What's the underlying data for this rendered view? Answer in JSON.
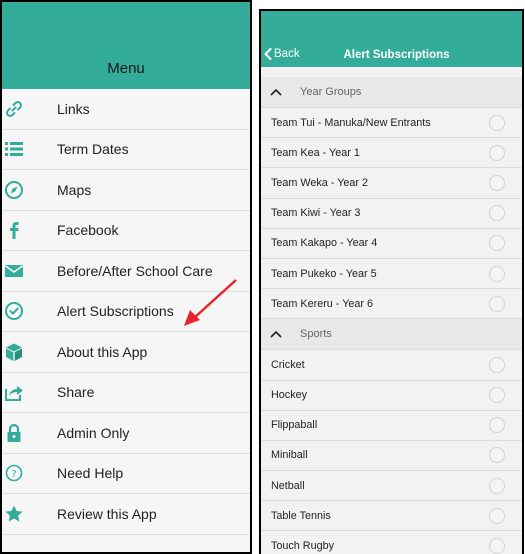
{
  "menu": {
    "title": "Menu",
    "accent": "#33ad9a",
    "items": [
      {
        "label": "Links",
        "icon": "link-icon"
      },
      {
        "label": "Term Dates",
        "icon": "list-icon"
      },
      {
        "label": "Maps",
        "icon": "compass-icon"
      },
      {
        "label": "Facebook",
        "icon": "facebook-icon"
      },
      {
        "label": "Before/After School Care",
        "icon": "envelope-icon"
      },
      {
        "label": "Alert Subscriptions",
        "icon": "check-circle-icon"
      },
      {
        "label": "About this App",
        "icon": "cube-icon"
      },
      {
        "label": "Share",
        "icon": "share-icon"
      },
      {
        "label": "Admin Only",
        "icon": "lock-icon"
      },
      {
        "label": "Need Help",
        "icon": "help-circle-icon"
      },
      {
        "label": "Review this App",
        "icon": "star-icon"
      }
    ]
  },
  "subscriptions": {
    "back_label": "Back",
    "title": "Alert Subscriptions",
    "sections": [
      {
        "title": "Year Groups",
        "items": [
          "Team Tui - Manuka/New Entrants",
          "Team Kea - Year 1",
          "Team Weka - Year 2",
          "Team Kiwi - Year 3",
          "Team Kakapo - Year 4",
          "Team Pukeko - Year 5",
          "Team Kereru - Year 6"
        ]
      },
      {
        "title": "Sports",
        "items": [
          "Cricket",
          "Hockey",
          "Flippaball",
          "Miniball",
          "Netball",
          "Table Tennis",
          "Touch Rugby"
        ]
      }
    ]
  },
  "annotation_color": "#e8262a"
}
